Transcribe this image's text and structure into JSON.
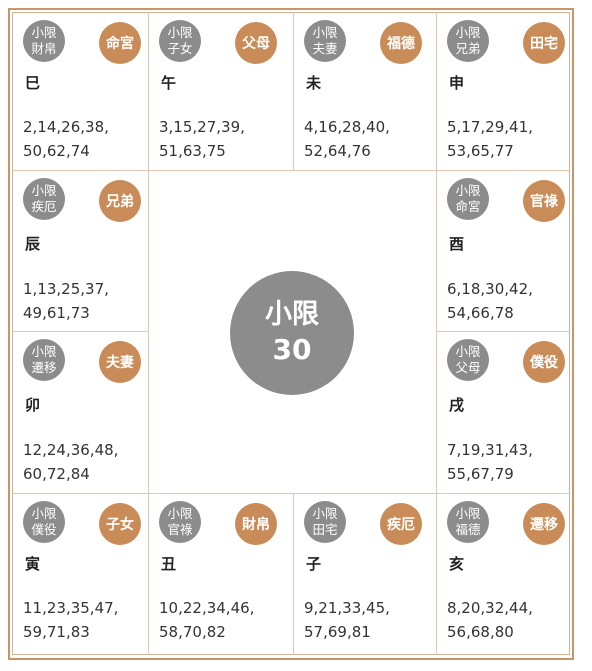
{
  "center": {
    "label": "小限",
    "value": "30"
  },
  "cells": [
    {
      "id": "si",
      "xiao1": "小限",
      "xiao2": "財帛",
      "palace": "命宮",
      "branch": "巳",
      "ages1": "2,14,26,38,",
      "ages2": "50,62,74"
    },
    {
      "id": "wu",
      "xiao1": "小限",
      "xiao2": "子女",
      "palace": "父母",
      "branch": "午",
      "ages1": "3,15,27,39,",
      "ages2": "51,63,75"
    },
    {
      "id": "wei",
      "xiao1": "小限",
      "xiao2": "夫妻",
      "palace": "福德",
      "branch": "未",
      "ages1": "4,16,28,40,",
      "ages2": "52,64,76"
    },
    {
      "id": "shen",
      "xiao1": "小限",
      "xiao2": "兄弟",
      "palace": "田宅",
      "branch": "申",
      "ages1": "5,17,29,41,",
      "ages2": "53,65,77"
    },
    {
      "id": "chen",
      "xiao1": "小限",
      "xiao2": "疾厄",
      "palace": "兄弟",
      "branch": "辰",
      "ages1": "1,13,25,37,",
      "ages2": "49,61,73"
    },
    {
      "id": "you",
      "xiao1": "小限",
      "xiao2": "命宮",
      "palace": "官祿",
      "branch": "酉",
      "ages1": "6,18,30,42,",
      "ages2": "54,66,78"
    },
    {
      "id": "mao",
      "xiao1": "小限",
      "xiao2": "遷移",
      "palace": "夫妻",
      "branch": "卯",
      "ages1": "12,24,36,48,",
      "ages2": "60,72,84"
    },
    {
      "id": "xu",
      "xiao1": "小限",
      "xiao2": "父母",
      "palace": "僕役",
      "branch": "戌",
      "ages1": "7,19,31,43,",
      "ages2": "55,67,79"
    },
    {
      "id": "yin",
      "xiao1": "小限",
      "xiao2": "僕役",
      "palace": "子女",
      "branch": "寅",
      "ages1": "11,23,35,47,",
      "ages2": "59,71,83"
    },
    {
      "id": "chou",
      "xiao1": "小限",
      "xiao2": "官祿",
      "palace": "財帛",
      "branch": "丑",
      "ages1": "10,22,34,46,",
      "ages2": "58,70,82"
    },
    {
      "id": "zi",
      "xiao1": "小限",
      "xiao2": "田宅",
      "palace": "疾厄",
      "branch": "子",
      "ages1": "9,21,33,45,",
      "ages2": "57,69,81"
    },
    {
      "id": "hai",
      "xiao1": "小限",
      "xiao2": "福德",
      "palace": "遷移",
      "branch": "亥",
      "ages1": "8,20,32,44,",
      "ages2": "56,68,80"
    }
  ]
}
